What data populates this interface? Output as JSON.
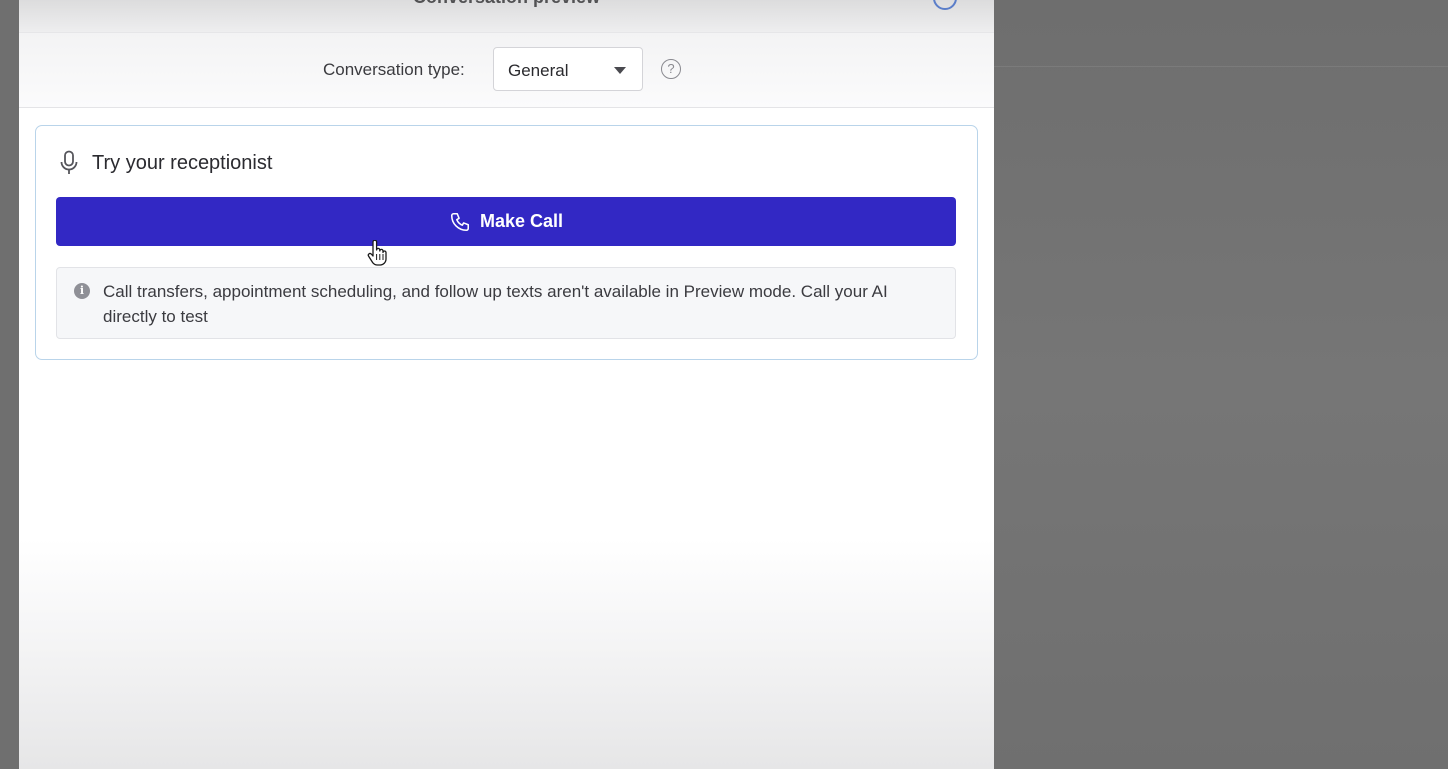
{
  "header": {
    "title": "Conversation preview"
  },
  "conversation_type": {
    "label": "Conversation type:",
    "selected": "General"
  },
  "card": {
    "title": "Try your receptionist",
    "make_call_label": "Make Call",
    "notice": "Call transfers, appointment scheduling, and follow up texts aren't available in Preview mode. Call your AI directly to test"
  },
  "icons": {
    "mic": "microphone-icon",
    "phone": "phone-icon",
    "info": "info-icon",
    "help": "help-circle-icon",
    "dropdown": "chevron-down-icon",
    "cursor": "hand-pointer-icon"
  },
  "colors": {
    "primary_button": "#3228c4",
    "card_border": "#b9d4ea",
    "backdrop": "#727272"
  }
}
